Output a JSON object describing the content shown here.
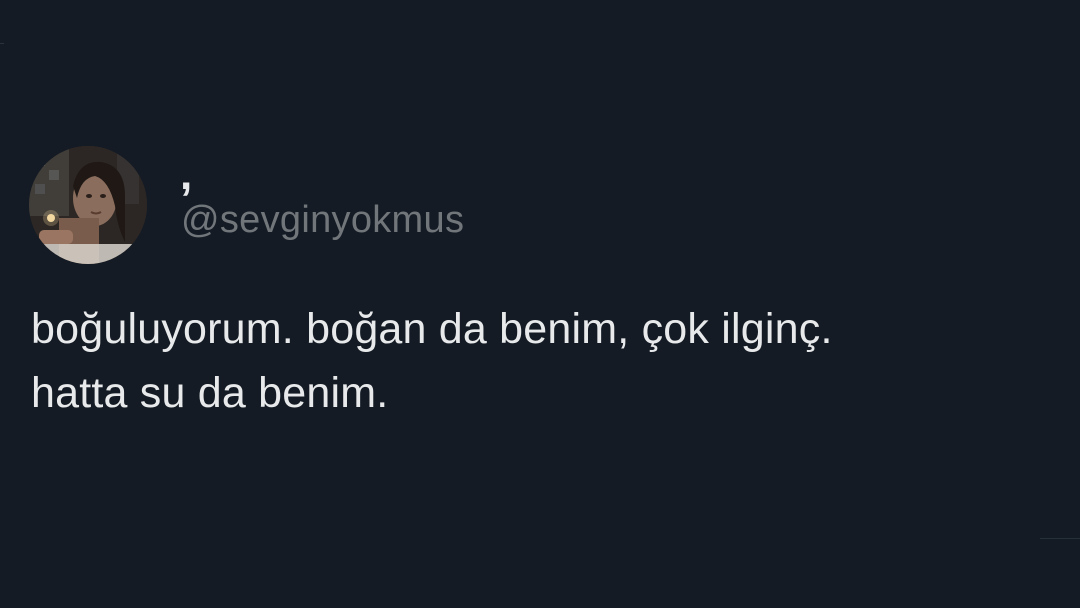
{
  "tweet": {
    "display_name": ",",
    "handle": "@sevginyokmus",
    "text_lines": [
      "boğuluyorum. boğan da benim, çok ilginç.",
      "hatta su da benim."
    ]
  },
  "colors": {
    "background": "#141b24",
    "text_primary": "#e7e9ea",
    "text_secondary": "#71767b"
  }
}
